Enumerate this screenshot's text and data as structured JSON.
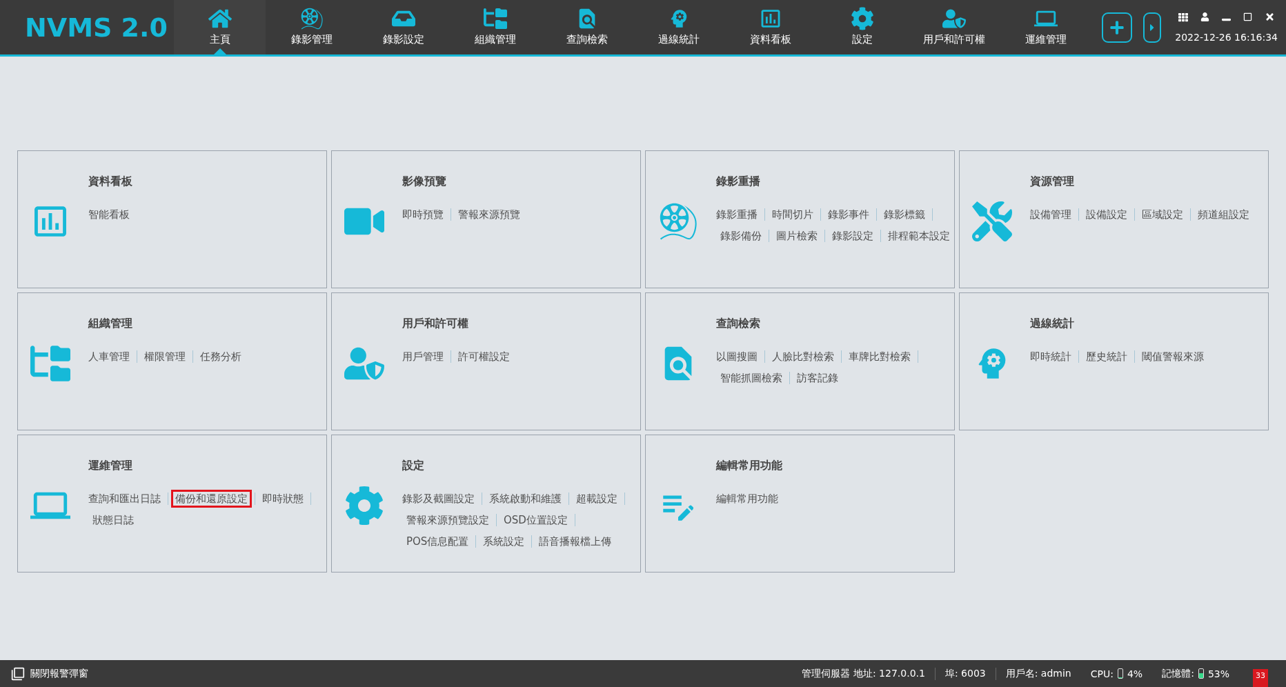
{
  "app": {
    "logo": "NVMS 2.0",
    "datetime": "2022-12-26 16:16:34"
  },
  "nav": [
    {
      "label": "主頁",
      "selected": true
    },
    {
      "label": "錄影管理",
      "selected": false
    },
    {
      "label": "錄影設定",
      "selected": false
    },
    {
      "label": "組織管理",
      "selected": false
    },
    {
      "label": "查詢檢索",
      "selected": false
    },
    {
      "label": "過線統計",
      "selected": false
    },
    {
      "label": "資料看板",
      "selected": false
    },
    {
      "label": "設定",
      "selected": false
    },
    {
      "label": "用戶和許可權",
      "selected": false
    },
    {
      "label": "運維管理",
      "selected": false
    }
  ],
  "cards": [
    {
      "title": "資料看板",
      "links": [
        {
          "label": "智能看板",
          "highlighted": false
        }
      ]
    },
    {
      "title": "影像預覽",
      "links": [
        {
          "label": "即時預覽",
          "highlighted": false
        },
        {
          "label": "警報來源預覽",
          "highlighted": false
        }
      ]
    },
    {
      "title": "錄影重播",
      "links": [
        {
          "label": "錄影重播",
          "highlighted": false
        },
        {
          "label": "時間切片",
          "highlighted": false
        },
        {
          "label": "錄影事件",
          "highlighted": false
        },
        {
          "label": "錄影標籤",
          "highlighted": false
        },
        {
          "label": "錄影備份",
          "highlighted": false
        },
        {
          "label": "圖片檢索",
          "highlighted": false
        },
        {
          "label": "錄影設定",
          "highlighted": false
        },
        {
          "label": "排程範本設定",
          "highlighted": false
        }
      ]
    },
    {
      "title": "資源管理",
      "links": [
        {
          "label": "設備管理",
          "highlighted": false
        },
        {
          "label": "設備設定",
          "highlighted": false
        },
        {
          "label": "區域設定",
          "highlighted": false
        },
        {
          "label": "頻道組設定",
          "highlighted": false
        }
      ]
    },
    {
      "title": "組織管理",
      "links": [
        {
          "label": "人車管理",
          "highlighted": false
        },
        {
          "label": "權限管理",
          "highlighted": false
        },
        {
          "label": "任務分析",
          "highlighted": false
        }
      ]
    },
    {
      "title": "用戶和許可權",
      "links": [
        {
          "label": "用戶管理",
          "highlighted": false
        },
        {
          "label": "許可權設定",
          "highlighted": false
        }
      ]
    },
    {
      "title": "查詢檢索",
      "links": [
        {
          "label": "以圖搜圖",
          "highlighted": false
        },
        {
          "label": "人臉比對檢索",
          "highlighted": false
        },
        {
          "label": "車牌比對檢索",
          "highlighted": false
        },
        {
          "label": "智能抓圖檢索",
          "highlighted": false
        },
        {
          "label": "訪客記錄",
          "highlighted": false
        }
      ]
    },
    {
      "title": "過線統計",
      "links": [
        {
          "label": "即時統計",
          "highlighted": false
        },
        {
          "label": "歷史統計",
          "highlighted": false
        },
        {
          "label": "閾值警報來源",
          "highlighted": false
        }
      ]
    },
    {
      "title": "運維管理",
      "links": [
        {
          "label": "查詢和匯出日誌",
          "highlighted": false
        },
        {
          "label": "備份和還原設定",
          "highlighted": true
        },
        {
          "label": "即時狀態",
          "highlighted": false
        },
        {
          "label": "狀態日誌",
          "highlighted": false
        }
      ]
    },
    {
      "title": "設定",
      "links": [
        {
          "label": "錄影及截圖設定",
          "highlighted": false
        },
        {
          "label": "系統啟動和維護",
          "highlighted": false
        },
        {
          "label": "超載設定",
          "highlighted": false
        },
        {
          "label": "警報來源預覽設定",
          "highlighted": false
        },
        {
          "label": "OSD位置設定",
          "highlighted": false
        },
        {
          "label": "POS信息配置",
          "highlighted": false
        },
        {
          "label": "系統設定",
          "highlighted": false
        },
        {
          "label": "語音播報檔上傳",
          "highlighted": false
        }
      ]
    },
    {
      "title": "編輯常用功能",
      "links": [
        {
          "label": "編輯常用功能",
          "highlighted": false
        }
      ]
    }
  ],
  "status_bar": {
    "alarm_popup_toggle": "關閉報警彈窗",
    "server": "管理伺服器 地址: 127.0.0.1",
    "port": "埠: 6003",
    "user": "用戶名: admin",
    "cpu": {
      "label": "CPU:",
      "level": 0.04,
      "reading": "4%"
    },
    "memory": {
      "label": "記憶體:",
      "level": 0.53,
      "reading": "53%"
    },
    "alarm_count": "33"
  }
}
